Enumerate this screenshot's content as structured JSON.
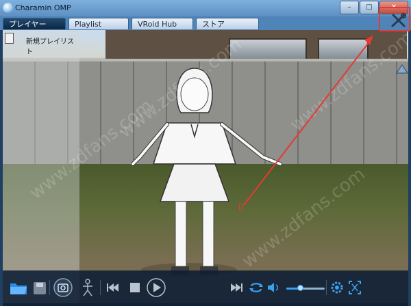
{
  "window": {
    "title": "Charamin OMP",
    "minimize_glyph": "–",
    "maximize_glyph": "□",
    "close_glyph": "✕"
  },
  "tabs": [
    {
      "label": "プレイヤー",
      "active": true
    },
    {
      "label": "Playlist",
      "active": false
    },
    {
      "label": "VRoid Hub",
      "active": false
    },
    {
      "label": "ストア",
      "active": false
    }
  ],
  "side_panel": {
    "title": "新規プレイリスト"
  },
  "icons": {
    "settings": "tools-icon",
    "playlist_doc": "document-icon",
    "scroll_up": "triangle-up-icon",
    "toolbar": [
      "folder-icon",
      "save-icon",
      "camera-icon",
      "pose-icon",
      "skip-previous-icon",
      "stop-icon",
      "play-icon",
      "skip-next-icon",
      "repeat-icon",
      "volume-icon",
      "settings-gear-icon",
      "fullscreen-icon"
    ]
  },
  "volume_level": 0.35,
  "watermark": "www.zdfans.com",
  "colors": {
    "accent": "#3aa0f0",
    "highlight": "#e53935",
    "tab_active": "#0d2740",
    "toolbar_bg": "#0d1e34"
  }
}
